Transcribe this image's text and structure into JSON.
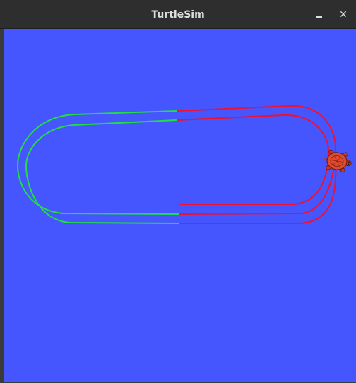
{
  "window": {
    "title": "TurtleSim"
  },
  "titlebar": {
    "minimize_icon": "minimize-icon",
    "close_icon": "close-icon",
    "close_glyph": "✕"
  },
  "canvas": {
    "background_color": "#4556ff",
    "pen_colors": {
      "green": "#22dd44",
      "red": "#ee1133"
    },
    "turtle_icon": "turtle-icon"
  }
}
